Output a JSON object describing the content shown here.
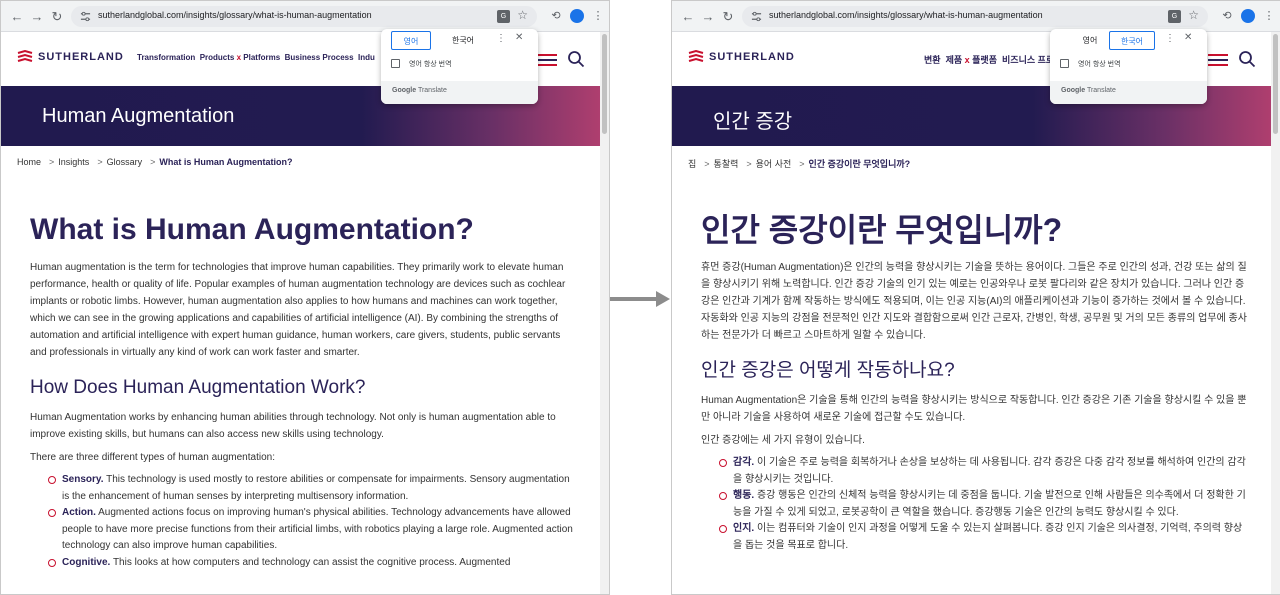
{
  "browser": {
    "url": "sutherlandglobal.com/insights/glossary/what-is-human-augmentation"
  },
  "site": {
    "logo_text": "SUTHERLAND"
  },
  "translate_popup": {
    "tab_source": "영어",
    "tab_target": "한국어",
    "always_translate": "영어 항상 번역",
    "footer_prefix": "Google",
    "footer_suffix": " Translate"
  },
  "left": {
    "nav": {
      "item1": "Transformation",
      "item2a": "Products ",
      "item2x": "x",
      "item2b": " Platforms",
      "item3": "Business Process",
      "item4": "Indu"
    },
    "hero_title": "Human Augmentation",
    "breadcrumb": {
      "home": "Home",
      "insights": "Insights",
      "glossary": "Glossary",
      "current": "What is Human Augmentation?"
    },
    "h1": "What is Human Augmentation?",
    "intro": "Human augmentation is the term for technologies that improve human capabilities. They primarily work to elevate human performance, health or quality of life. Popular examples of human augmentation technology are devices such as cochlear implants or robotic limbs. However, human augmentation also applies to how humans and machines can work together, which we can see in the growing applications and capabilities of artificial intelligence (AI). By combining the strengths of automation and artificial intelligence with expert human guidance, human workers, care givers, students, public servants and professionals in virtually any kind of work can work faster and smarter.",
    "h2": "How Does Human Augmentation Work?",
    "p2": "Human Augmentation works by enhancing human abilities through technology. Not only is human augmentation able to improve existing skills, but humans can also access new skills using technology.",
    "p3": "There are three different types of human augmentation:",
    "list": [
      {
        "term": "Sensory.",
        "text": " This technology is used mostly to restore abilities or compensate for impairments. Sensory augmentation is the enhancement of human senses by interpreting multisensory information."
      },
      {
        "term": "Action.",
        "text": " Augmented actions focus on improving human's physical abilities. Technology advancements have allowed people to have more precise functions from their artificial limbs, with robotics playing a large role. Augmented action technology can also improve human capabilities."
      },
      {
        "term": "Cognitive.",
        "text": " This looks at how computers and technology can assist the cognitive process. Augmented"
      }
    ]
  },
  "right": {
    "nav": {
      "item1": "변환",
      "item2a": "제품 ",
      "item2x": "x",
      "item2b": " 플랫폼",
      "item3": "비즈니스 프로"
    },
    "hero_title": "인간 증강",
    "breadcrumb": {
      "home": "집",
      "insights": "통찰력",
      "glossary": "용어 사전",
      "current": "인간 증강이란 무엇입니까?"
    },
    "h1": "인간 증강이란 무엇입니까?",
    "intro": "휴먼 증강(Human Augmentation)은 인간의 능력을 향상시키는 기술을 뜻하는 용어이다. 그들은 주로 인간의 성과, 건강 또는 삶의 질을 향상시키기 위해 노력합니다. 인간 증강 기술의 인기 있는 예로는 인공와우나 로봇 팔다리와 같은 장치가 있습니다. 그러나 인간 증강은 인간과 기계가 함께 작동하는 방식에도 적용되며, 이는 인공 지능(AI)의 애플리케이션과 기능이 증가하는 것에서 볼 수 있습니다. 자동화와 인공 지능의 강점을 전문적인 인간 지도와 결합함으로써 인간 근로자, 간병인, 학생, 공무원 및 거의 모든 종류의 업무에 종사하는 전문가가 더 빠르고 스마트하게 일할 수 있습니다.",
    "h2": "인간 증강은 어떻게 작동하나요?",
    "p2": "Human Augmentation은 기술을 통해 인간의 능력을 향상시키는 방식으로 작동합니다. 인간 증강은 기존 기술을 향상시킬 수 있을 뿐만 아니라 기술을 사용하여 새로운 기술에 접근할 수도 있습니다.",
    "p3": "인간 증강에는 세 가지 유형이 있습니다.",
    "list": [
      {
        "term": "감각.",
        "text": " 이 기술은 주로 능력을 회복하거나 손상을 보상하는 데 사용됩니다. 감각 증강은 다중 감각 정보를 해석하여 인간의 감각을 향상시키는 것입니다."
      },
      {
        "term": "행동.",
        "text": " 증강 행동은 인간의 신체적 능력을 향상시키는 데 중점을 둡니다. 기술 발전으로 인해 사람들은 의수족에서 더 정확한 기능을 가질 수 있게 되었고, 로봇공학이 큰 역할을 했습니다. 증강행동 기술은 인간의 능력도 향상시킬 수 있다."
      },
      {
        "term": "인지.",
        "text": " 이는 컴퓨터와 기술이 인지 과정을 어떻게 도울 수 있는지 살펴봅니다. 증강 인지 기술은 의사결정, 기억력, 주의력 향상을 돕는 것을 목표로 합니다."
      }
    ]
  }
}
